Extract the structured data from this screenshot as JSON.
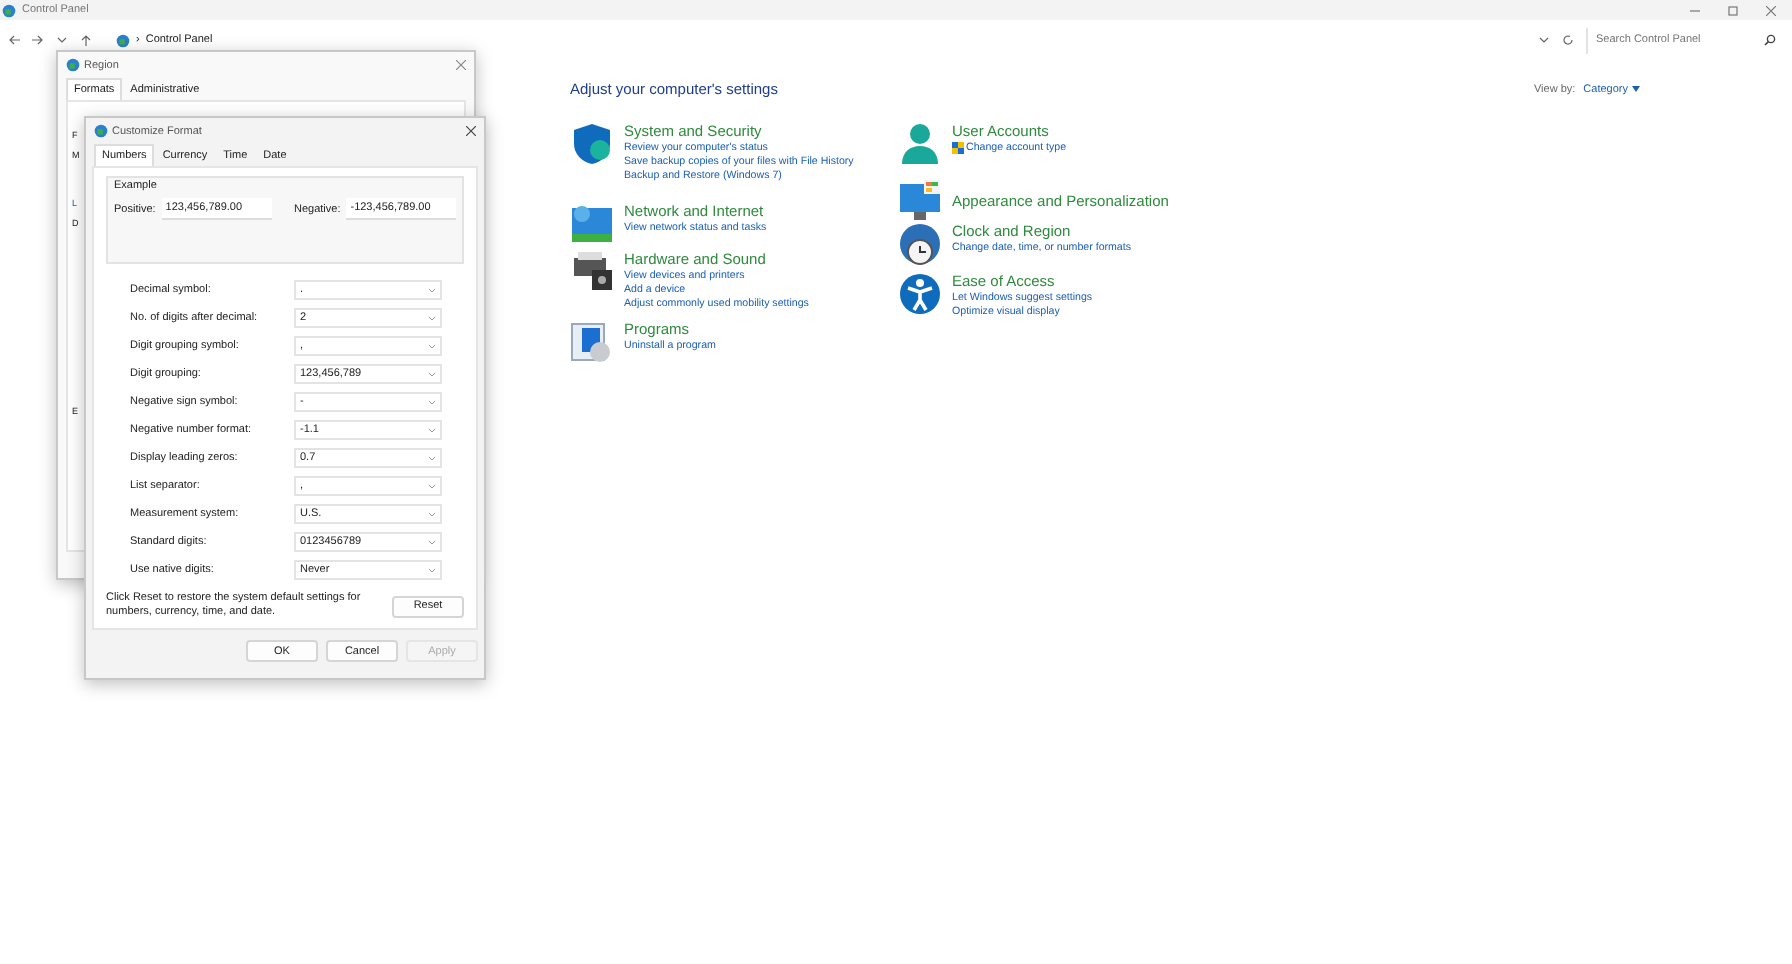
{
  "window": {
    "title": "Control Panel",
    "breadcrumb_separator": "›",
    "breadcrumb": "Control Panel",
    "search": {
      "placeholder": "Search Control Panel"
    }
  },
  "content": {
    "heading": "Adjust your computer's settings",
    "view_by_label": "View by:",
    "view_by_value": "Category",
    "columns": [
      [
        {
          "title": "System and Security",
          "links": [
            "Review your computer's status",
            "Save backup copies of your files with File History",
            "Backup and Restore (Windows 7)"
          ]
        },
        {
          "title": "Network and Internet",
          "links": [
            "View network status and tasks"
          ]
        },
        {
          "title": "Hardware and Sound",
          "links": [
            "View devices and printers",
            "Add a device",
            "Adjust commonly used mobility settings"
          ]
        },
        {
          "title": "Programs",
          "links": [
            "Uninstall a program"
          ]
        }
      ],
      [
        {
          "title": "User Accounts",
          "links": [
            "Change account type"
          ]
        },
        {
          "title": "Appearance and Personalization"
        },
        {
          "title": "Clock and Region",
          "links": [
            "Change date, time, or number formats"
          ]
        },
        {
          "title": "Ease of Access",
          "links": [
            "Let Windows suggest settings",
            "Optimize visual display"
          ]
        }
      ]
    ]
  },
  "region_dialog": {
    "title": "Region",
    "tabs": [
      {
        "label": "Formats",
        "selected": true
      },
      {
        "label": "Administrative",
        "selected": false
      }
    ],
    "fragments": [
      "F",
      "M",
      "L",
      "D",
      "E"
    ]
  },
  "customize_dialog": {
    "title": "Customize Format",
    "tabs": [
      {
        "label": "Numbers",
        "selected": true
      },
      {
        "label": "Currency",
        "selected": false
      },
      {
        "label": "Time",
        "selected": false
      },
      {
        "label": "Date",
        "selected": false
      }
    ],
    "example": {
      "label": "Example",
      "positive_label": "Positive:",
      "positive_value": "123,456,789.00",
      "negative_label": "Negative:",
      "negative_value": "-123,456,789.00"
    },
    "settings": [
      {
        "label": "Decimal symbol:",
        "value": "."
      },
      {
        "label": "No. of digits after decimal:",
        "value": "2"
      },
      {
        "label": "Digit grouping symbol:",
        "value": ","
      },
      {
        "label": "Digit grouping:",
        "value": "123,456,789"
      },
      {
        "label": "Negative sign symbol:",
        "value": "-"
      },
      {
        "label": "Negative number format:",
        "value": "-1.1"
      },
      {
        "label": "Display leading zeros:",
        "value": "0.7"
      },
      {
        "label": "List separator:",
        "value": ","
      },
      {
        "label": "Measurement system:",
        "value": "U.S."
      },
      {
        "label": "Standard digits:",
        "value": "0123456789"
      },
      {
        "label": "Use native digits:",
        "value": "Never"
      }
    ],
    "note": "Click Reset to restore the system default settings for numbers, currency, time, and date.",
    "reset_button": "Reset",
    "buttons": [
      {
        "label": "OK",
        "disabled": false
      },
      {
        "label": "Cancel",
        "disabled": false
      },
      {
        "label": "Apply",
        "disabled": true
      }
    ]
  }
}
